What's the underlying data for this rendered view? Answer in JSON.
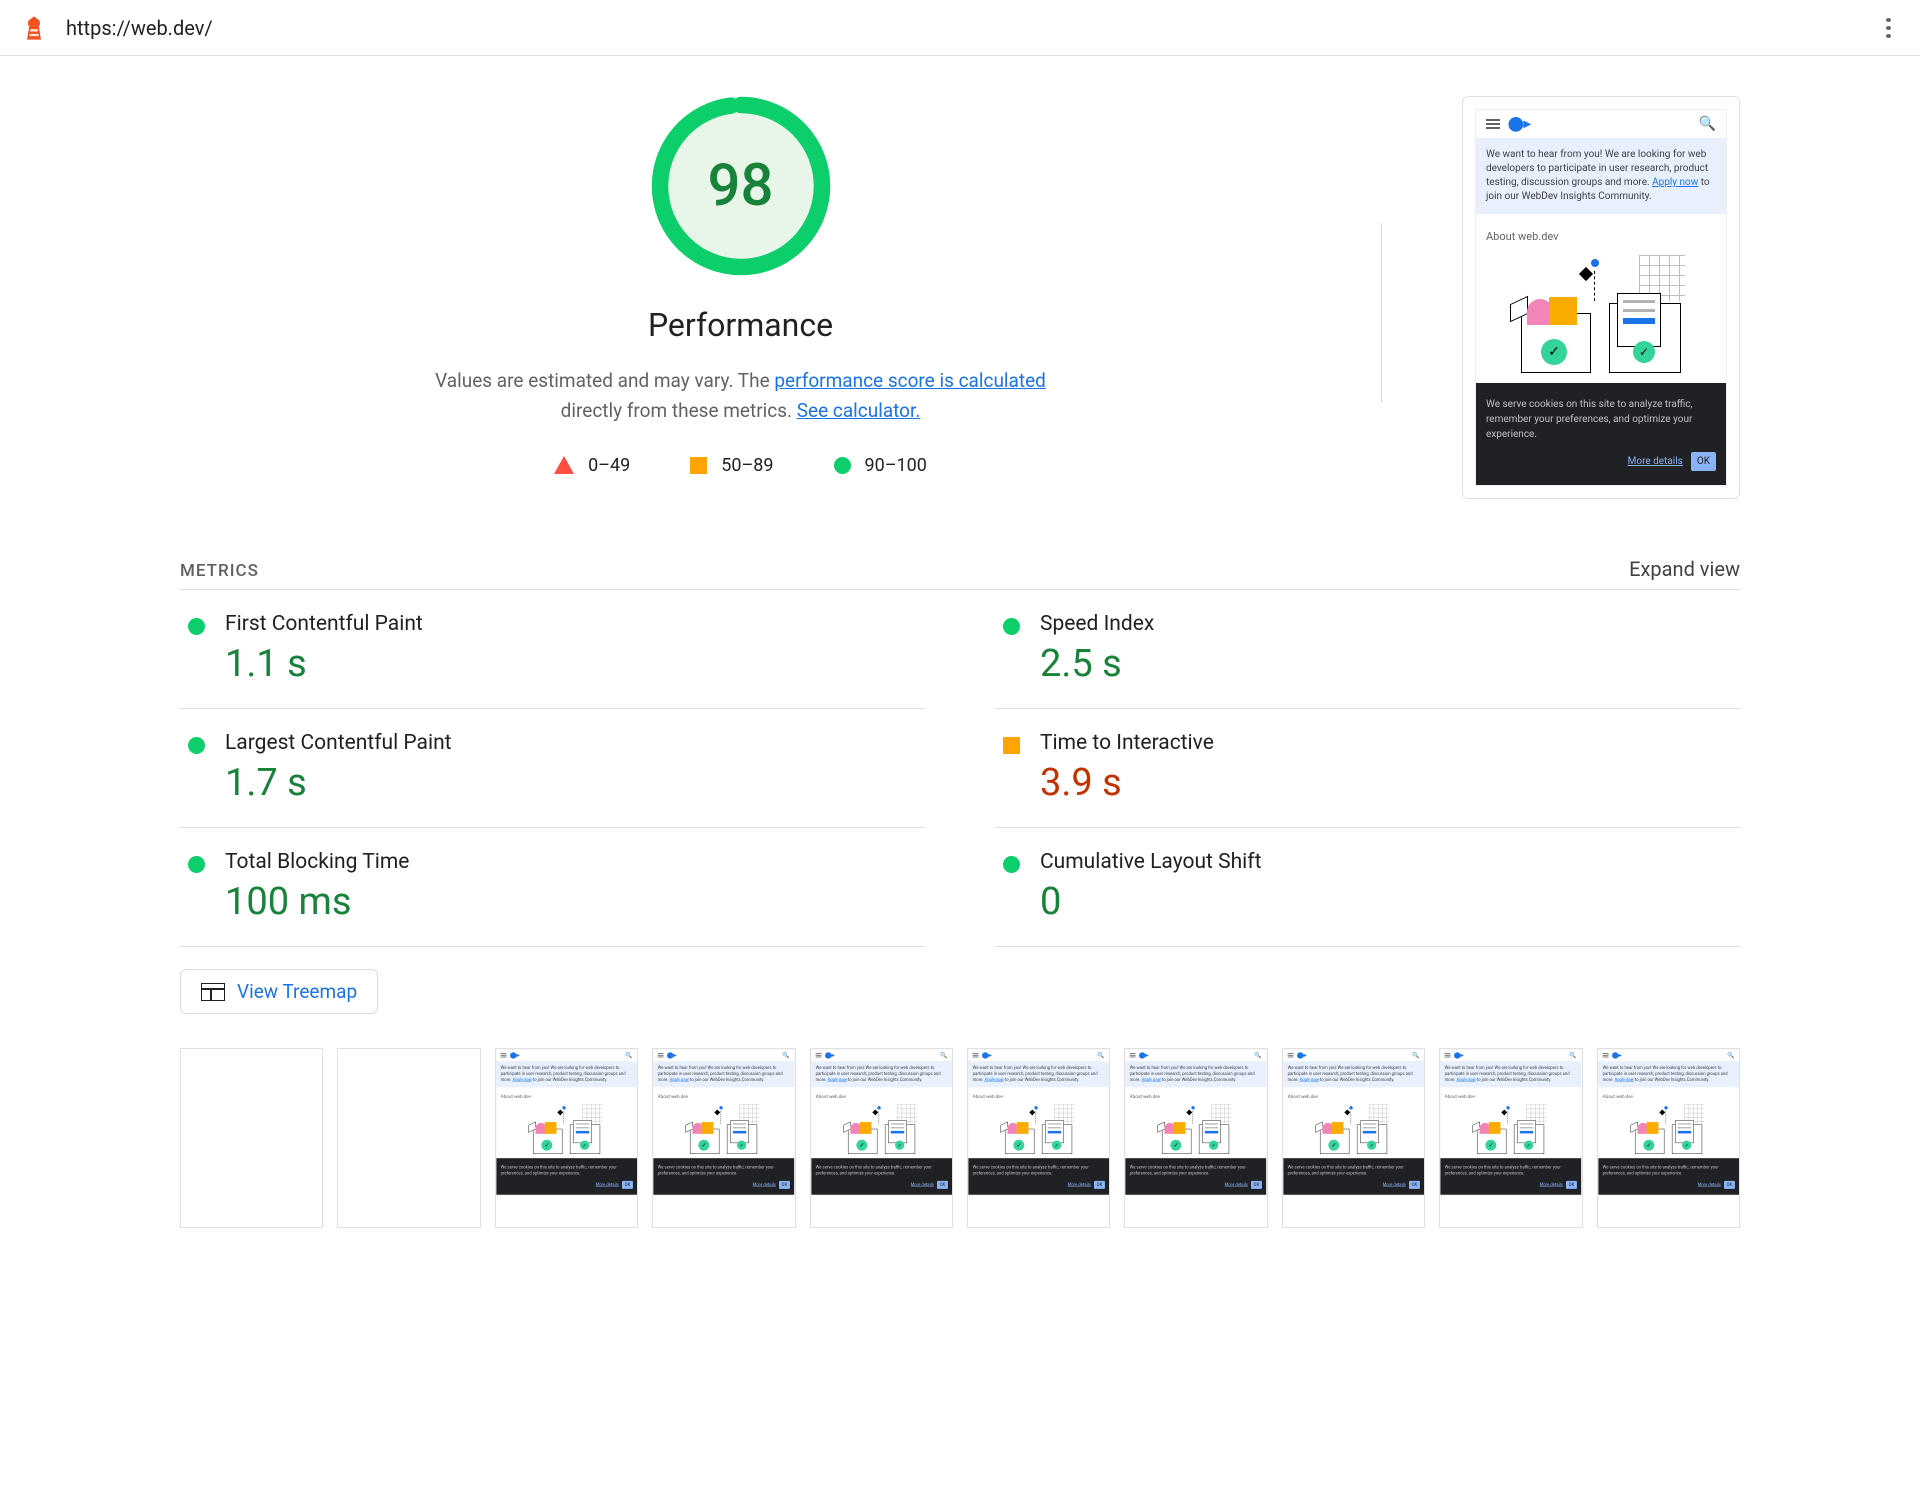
{
  "header": {
    "url": "https://web.dev/"
  },
  "summary": {
    "score": "98",
    "category": "Performance",
    "desc_pre": "Values are estimated and may vary. The ",
    "link1": "performance score is calculated",
    "desc_mid": " directly from these metrics. ",
    "link2": "See calculator."
  },
  "legend": {
    "fail": "0–49",
    "avg": "50–89",
    "pass": "90–100"
  },
  "preview": {
    "banner_pre": "We want to hear from you! We are looking for web developers to participate in user research, product testing, discussion groups and more. ",
    "banner_link": "Apply now",
    "banner_post": " to join our WebDev Insights Community.",
    "about": "About web.dev",
    "cookie": "We serve cookies on this site to analyze traffic, remember your preferences, and optimize your experience.",
    "more": "More details",
    "ok": "OK"
  },
  "metrics": {
    "heading": "METRICS",
    "expand": "Expand view",
    "items": [
      {
        "name": "First Contentful Paint",
        "value": "1.1 s",
        "status": "pass"
      },
      {
        "name": "Speed Index",
        "value": "2.5 s",
        "status": "pass"
      },
      {
        "name": "Largest Contentful Paint",
        "value": "1.7 s",
        "status": "pass"
      },
      {
        "name": "Time to Interactive",
        "value": "3.9 s",
        "status": "avg"
      },
      {
        "name": "Total Blocking Time",
        "value": "100 ms",
        "status": "pass"
      },
      {
        "name": "Cumulative Layout Shift",
        "value": "0",
        "status": "pass"
      }
    ]
  },
  "actions": {
    "treemap": "View Treemap"
  },
  "filmstrip_blank_count": 2,
  "filmstrip_full_count": 8,
  "colors": {
    "pass": "#0cce6b",
    "avg": "#ffa400",
    "fail": "#ff4e42",
    "link": "#1a73e8",
    "score_text": "#178239",
    "avg_text": "#c33300"
  }
}
